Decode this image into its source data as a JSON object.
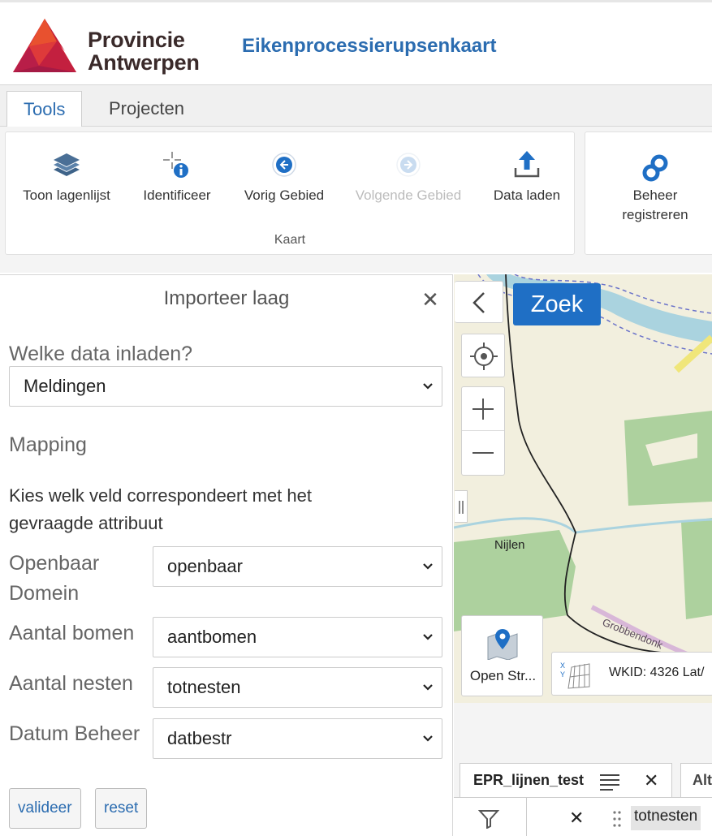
{
  "header": {
    "logo_line1": "Provincie",
    "logo_line2": "Antwerpen",
    "app_title": "Eikenprocessierupsenkaart"
  },
  "tabs": [
    {
      "label": "Tools",
      "active": true
    },
    {
      "label": "Projecten",
      "active": false
    }
  ],
  "ribbon": {
    "kaart_group_label": "Kaart",
    "buttons": [
      {
        "label": "Toon lagenlijst",
        "icon": "layers-icon",
        "enabled": true
      },
      {
        "label": "Identificeer",
        "icon": "identify-icon",
        "enabled": true
      },
      {
        "label": "Vorig Gebied",
        "icon": "previous-extent-icon",
        "enabled": true
      },
      {
        "label": "Volgende Gebied",
        "icon": "next-extent-icon",
        "enabled": false
      },
      {
        "label": "Data laden",
        "icon": "upload-icon",
        "enabled": true
      }
    ],
    "beheer_button": {
      "label_line1": "Beheer",
      "label_line2": "registreren",
      "icon": "link-icon"
    }
  },
  "panel": {
    "title": "Importeer laag",
    "question": "Welke data inladen?",
    "data_select": "Meldingen",
    "mapping_heading": "Mapping",
    "instruction": "Kies welk veld correspondeert met het gevraagde attribuut",
    "fields": [
      {
        "label_line1": "Openbaar",
        "label_line2": "Domein",
        "value": "openbaar"
      },
      {
        "label_line1": "Aantal bomen",
        "label_line2": "",
        "value": "aantbomen"
      },
      {
        "label_line1": "Aantal nesten",
        "label_line2": "",
        "value": "totnesten"
      },
      {
        "label_line1": "Datum Beheer",
        "label_line2": "",
        "value": "datbestr"
      }
    ],
    "validate_label": "valideer",
    "reset_label": "reset"
  },
  "map": {
    "search_label": "Zoek",
    "place_label": "Nijlen",
    "road_label": "Grobbendonk",
    "basemap_label": "Open Str...",
    "coord_label": "WKID: 4326 Lat/"
  },
  "table": {
    "tab_label": "EPR_lijnen_test",
    "tab2_label": "Alt",
    "column_label": "totnesten"
  },
  "colors": {
    "accent_blue": "#2b6cb0",
    "search_button": "#1f6fc5",
    "logo_red": "#d4273a"
  }
}
